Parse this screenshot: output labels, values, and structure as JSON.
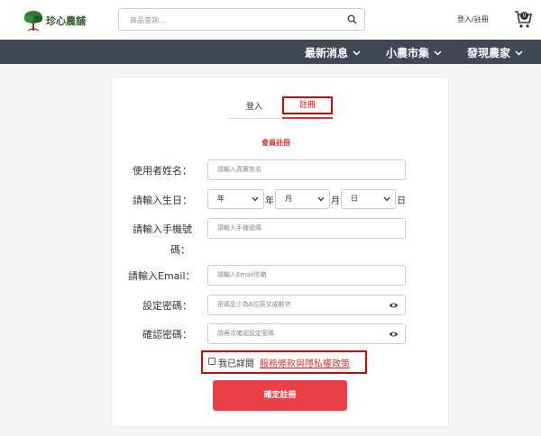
{
  "header": {
    "logo_text": "珍心農舖",
    "search_placeholder": "商品查詢...",
    "login_register": "登入/註冊",
    "cart_count": "0"
  },
  "nav": {
    "items": [
      {
        "label": "最新消息"
      },
      {
        "label": "小農市集"
      },
      {
        "label": "發現農家"
      }
    ]
  },
  "tabs": {
    "login": "登入",
    "register": "註冊"
  },
  "form": {
    "title": "會員註冊",
    "name_label": "使用者姓名：",
    "name_placeholder": "請輸入真實姓名",
    "birthday_label": "請輸入生日：",
    "year_value": "年",
    "year_unit": "年",
    "month_value": "月",
    "month_unit": "月",
    "day_value": "日",
    "day_unit": "日",
    "phone_label_line1": "請輸入手機號",
    "phone_label_line2": "碼：",
    "phone_placeholder": "請輸入手機號碼",
    "email_label": "請輸入Email：",
    "email_placeholder": "請輸入Email信箱",
    "password_label": "設定密碼：",
    "password_placeholder": "密碼至少為6位英文或數字",
    "confirm_label": "確認密碼：",
    "confirm_placeholder": "請再次確認設定密碼",
    "agree_text": "我已詳閱",
    "agree_link": "服務條款與隱私權政策",
    "submit": "確定註冊"
  },
  "colors": {
    "nav_bg": "#414755",
    "accent_red": "#d33",
    "submit_bg": "#e94048"
  }
}
